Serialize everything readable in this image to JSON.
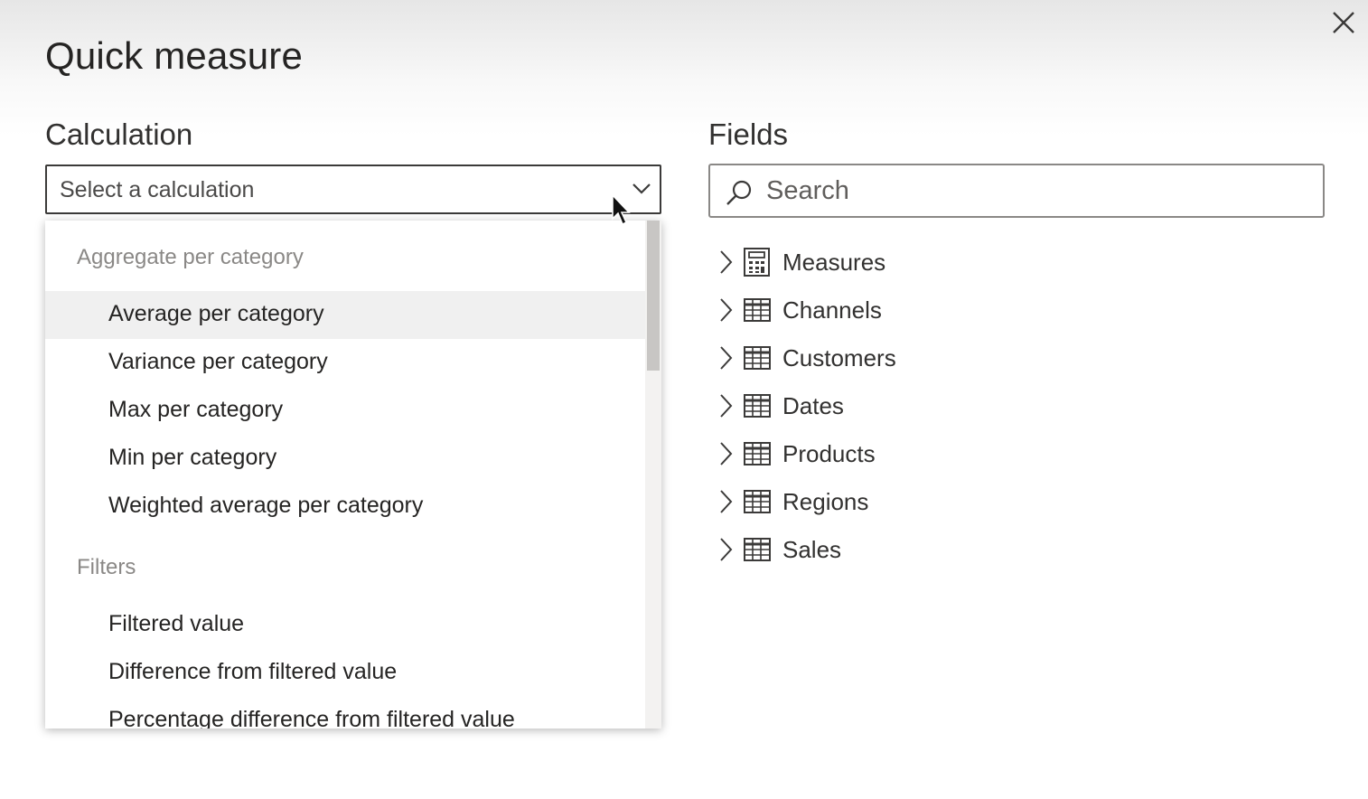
{
  "dialog": {
    "title": "Quick measure"
  },
  "calculation": {
    "label": "Calculation",
    "placeholder": "Select a calculation",
    "dropdown": {
      "groups": [
        {
          "label": "Aggregate per category",
          "items": [
            "Average per category",
            "Variance per category",
            "Max per category",
            "Min per category",
            "Weighted average per category"
          ]
        },
        {
          "label": "Filters",
          "items": [
            "Filtered value",
            "Difference from filtered value",
            "Percentage difference from filtered value"
          ]
        }
      ],
      "highlighted_item": "Average per category"
    }
  },
  "fields": {
    "label": "Fields",
    "search_placeholder": "Search",
    "tables": [
      {
        "name": "Measures",
        "icon": "calculator-icon"
      },
      {
        "name": "Channels",
        "icon": "table-icon"
      },
      {
        "name": "Customers",
        "icon": "table-icon"
      },
      {
        "name": "Dates",
        "icon": "table-icon"
      },
      {
        "name": "Products",
        "icon": "table-icon"
      },
      {
        "name": "Regions",
        "icon": "table-icon"
      },
      {
        "name": "Sales",
        "icon": "table-icon"
      }
    ]
  },
  "colors": {
    "text": "#252423",
    "muted": "#8a8886",
    "highlight": "#f0f0f0",
    "border": "#3b3a39"
  }
}
